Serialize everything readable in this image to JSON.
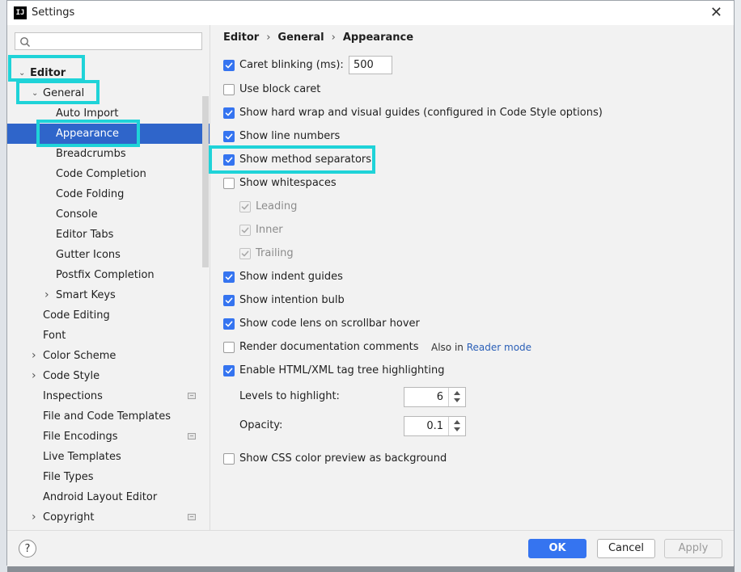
{
  "window": {
    "title": "Settings",
    "app_icon_text": "IJ"
  },
  "search": {
    "placeholder": ""
  },
  "tree": [
    {
      "label": "Editor",
      "level": 0,
      "expander": "expanded",
      "bold": true
    },
    {
      "label": "General",
      "level": 1,
      "expander": "expanded"
    },
    {
      "label": "Auto Import",
      "level": 2
    },
    {
      "label": "Appearance",
      "level": 2,
      "selected": true
    },
    {
      "label": "Breadcrumbs",
      "level": 2
    },
    {
      "label": "Code Completion",
      "level": 2
    },
    {
      "label": "Code Folding",
      "level": 2
    },
    {
      "label": "Console",
      "level": 2
    },
    {
      "label": "Editor Tabs",
      "level": 2
    },
    {
      "label": "Gutter Icons",
      "level": 2
    },
    {
      "label": "Postfix Completion",
      "level": 2
    },
    {
      "label": "Smart Keys",
      "level": 2,
      "expander": "collapsed"
    },
    {
      "label": "Code Editing",
      "level": 1
    },
    {
      "label": "Font",
      "level": 1
    },
    {
      "label": "Color Scheme",
      "level": 1,
      "expander": "collapsed"
    },
    {
      "label": "Code Style",
      "level": 1,
      "expander": "collapsed"
    },
    {
      "label": "Inspections",
      "level": 1,
      "project_icon": true
    },
    {
      "label": "File and Code Templates",
      "level": 1
    },
    {
      "label": "File Encodings",
      "level": 1,
      "project_icon": true
    },
    {
      "label": "Live Templates",
      "level": 1
    },
    {
      "label": "File Types",
      "level": 1
    },
    {
      "label": "Android Layout Editor",
      "level": 1
    },
    {
      "label": "Copyright",
      "level": 1,
      "expander": "collapsed",
      "project_icon": true
    }
  ],
  "breadcrumb": [
    "Editor",
    "General",
    "Appearance"
  ],
  "breadcrumb_sep": "›",
  "options": {
    "caret_blinking": {
      "label": "Caret blinking (ms):",
      "checked": true,
      "value": "500"
    },
    "block_caret": {
      "label": "Use block caret",
      "checked": false
    },
    "hard_wrap": {
      "label": "Show hard wrap and visual guides (configured in Code Style options)",
      "checked": true
    },
    "line_numbers": {
      "label": "Show line numbers",
      "checked": true
    },
    "method_separators": {
      "label": "Show method separators",
      "checked": true
    },
    "whitespaces": {
      "label": "Show whitespaces",
      "checked": false
    },
    "leading": {
      "label": "Leading",
      "checked": true,
      "disabled": true
    },
    "inner": {
      "label": "Inner",
      "checked": true,
      "disabled": true
    },
    "trailing": {
      "label": "Trailing",
      "checked": true,
      "disabled": true
    },
    "indent_guides": {
      "label": "Show indent guides",
      "checked": true
    },
    "intention_bulb": {
      "label": "Show intention bulb",
      "checked": true
    },
    "code_lens": {
      "label": "Show code lens on scrollbar hover",
      "checked": true
    },
    "render_docs": {
      "label": "Render documentation comments",
      "checked": false,
      "also_prefix": "Also in",
      "also_link": "Reader mode"
    },
    "tag_tree": {
      "label": "Enable HTML/XML tag tree highlighting",
      "checked": true
    },
    "levels": {
      "label": "Levels to highlight:",
      "value": "6"
    },
    "opacity": {
      "label": "Opacity:",
      "value": "0.1"
    },
    "css_preview": {
      "label": "Show CSS color preview as background",
      "checked": false
    }
  },
  "footer": {
    "help": "?",
    "ok": "OK",
    "cancel": "Cancel",
    "apply": "Apply"
  },
  "colors": {
    "accent": "#3574f0",
    "selection": "#2f65ca",
    "highlight": "#1fd3d8",
    "link": "#2a5fb7"
  }
}
